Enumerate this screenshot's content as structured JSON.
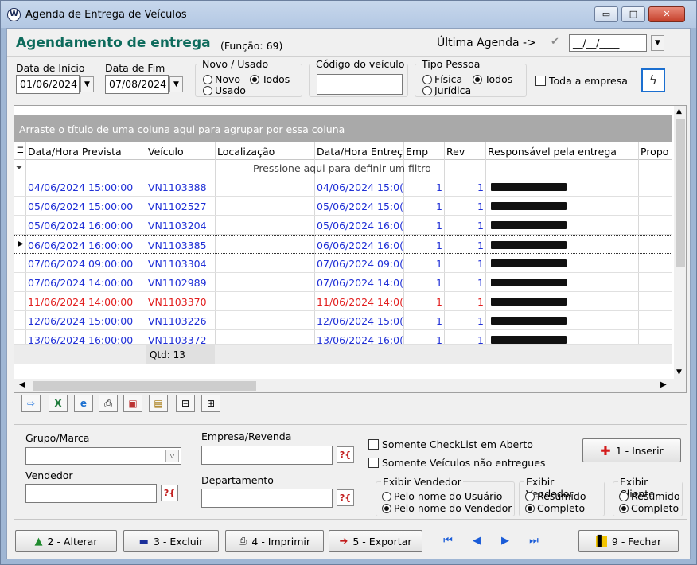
{
  "window": {
    "title": "Agenda de Entrega de Veículos",
    "controls": {
      "minimize": "▭",
      "maximize": "□",
      "close": "✕"
    }
  },
  "header": {
    "title": "Agendamento de entrega",
    "function_text": "(Função: 69)",
    "ultima_label": "Última Agenda ->",
    "ultima_value": "__/__/____"
  },
  "filters": {
    "data_inicio_label": "Data de Início",
    "data_inicio_value": "01/06/2024",
    "data_fim_label": "Data de Fim",
    "data_fim_value": "07/08/2024",
    "novo_usado": {
      "label": "Novo / Usado",
      "novo": "Novo",
      "todos": "Todos",
      "usado": "Usado",
      "selected": "Todos"
    },
    "codigo_veiculo_label": "Código do veículo",
    "codigo_veiculo_value": "",
    "tipo_pessoa": {
      "label": "Tipo Pessoa",
      "fisica": "Física",
      "todos": "Todos",
      "juridica": "Jurídica",
      "selected": "Todos"
    },
    "toda_empresa_label": "Toda a empresa"
  },
  "grid": {
    "group_hint": "Arraste o título de uma coluna aqui para agrupar por essa coluna",
    "columns": [
      "Data/Hora Prevista",
      "Veículo",
      "Localização",
      "Data/Hora Entreç",
      "Emp",
      "Rev",
      "Responsável pela entrega",
      "Propo"
    ],
    "filter_hint": "Pressione aqui para definir um filtro",
    "rows": [
      {
        "data": "04/06/2024 15:00:00",
        "veiculo": "VN1103388",
        "entrega": "04/06/2024 15:0(",
        "emp": "1",
        "rev": "1",
        "color": "blue"
      },
      {
        "data": "05/06/2024 15:00:00",
        "veiculo": "VN1102527",
        "entrega": "05/06/2024 15:0(",
        "emp": "1",
        "rev": "1",
        "color": "blue"
      },
      {
        "data": "05/06/2024 16:00:00",
        "veiculo": "VN1103204",
        "entrega": "05/06/2024 16:0(",
        "emp": "1",
        "rev": "1",
        "color": "blue"
      },
      {
        "data": "06/06/2024 16:00:00",
        "veiculo": "VN1103385",
        "entrega": "06/06/2024 16:0(",
        "emp": "1",
        "rev": "1",
        "color": "blue"
      },
      {
        "data": "07/06/2024 09:00:00",
        "veiculo": "VN1103304",
        "entrega": "07/06/2024 09:0(",
        "emp": "1",
        "rev": "1",
        "color": "blue"
      },
      {
        "data": "07/06/2024 14:00:00",
        "veiculo": "VN1102989",
        "entrega": "07/06/2024 14:0(",
        "emp": "1",
        "rev": "1",
        "color": "blue"
      },
      {
        "data": "11/06/2024 14:00:00",
        "veiculo": "VN1103370",
        "entrega": "11/06/2024 14:0(",
        "emp": "1",
        "rev": "1",
        "color": "red"
      },
      {
        "data": "12/06/2024 15:00:00",
        "veiculo": "VN1103226",
        "entrega": "12/06/2024 15:0(",
        "emp": "1",
        "rev": "1",
        "color": "blue"
      },
      {
        "data": "13/06/2024 16:00:00",
        "veiculo": "VN1103372",
        "entrega": "13/06/2024 16:0(",
        "emp": "1",
        "rev": "1",
        "color": "blue"
      }
    ],
    "footer_count": "Qtd: 13"
  },
  "bottom": {
    "grupo_marca_label": "Grupo/Marca",
    "empresa_revenda_label": "Empresa/Revenda",
    "vendedor_label": "Vendedor",
    "departamento_label": "Departamento",
    "somente_checklist": "Somente CheckList em Aberto",
    "somente_nao_entregues": "Somente Veículos não entregues",
    "inserir": "1 - Inserir",
    "exibir_vendedor1": {
      "label": "Exibir Vendedor",
      "opt1": "Pelo nome do Usuário",
      "opt2": "Pelo nome do Vendedor"
    },
    "exibir_vendedor2": {
      "label": "Exibir Vendedor",
      "opt1": "Resumido",
      "opt2": "Completo"
    },
    "exibir_cliente": {
      "label": "Exibir Cliente",
      "opt1": "Resumido",
      "opt2": "Completo"
    }
  },
  "buttons": {
    "alterar": "2 - Alterar",
    "excluir": "3 - Excluir",
    "imprimir": "4 - Imprimir",
    "exportar": "5 - Exportar",
    "fechar": "9 - Fechar"
  },
  "colors": {
    "heading": "#0d6b5c",
    "row_blue": "#1f2fd6",
    "row_red": "#e21e1e"
  }
}
